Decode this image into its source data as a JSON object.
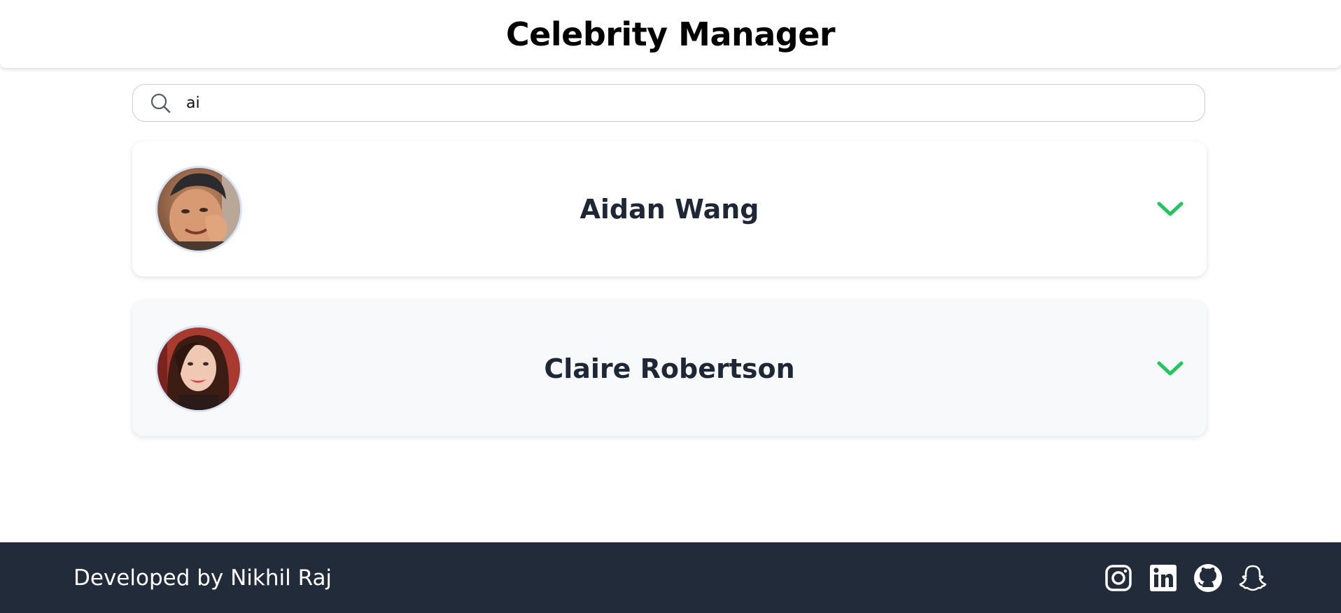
{
  "app": {
    "title": "Celebrity Manager"
  },
  "search": {
    "value": "ai",
    "placeholder": ""
  },
  "celebrities": [
    {
      "name": "Aidan Wang"
    },
    {
      "name": "Claire Robertson"
    }
  ],
  "footer": {
    "credit": "Developed by Nikhil Raj",
    "social": [
      "instagram-icon",
      "linkedin-icon",
      "github-icon",
      "snapchat-icon"
    ]
  },
  "colors": {
    "accent": "#22c55e",
    "footer_bg": "#222b3a",
    "name_text": "#1e2736"
  }
}
